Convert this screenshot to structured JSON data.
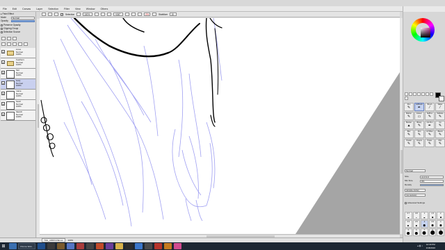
{
  "menu": {
    "items": [
      "File",
      "Edit",
      "Canvas",
      "Layer",
      "Selection",
      "Filter",
      "View",
      "Window",
      "Others"
    ]
  },
  "toolbar": {
    "selection_label": "Selection",
    "zoom": "100%",
    "angle": "+000°",
    "stabilizer_label": "Stabilizer",
    "stabilizer_value": "15",
    "red_value": "0%"
  },
  "left_panel": {
    "title": "Paint Effect",
    "mode_label": "Mode",
    "mode_value": "Normal",
    "opacity_label": "Opacity",
    "opacity_value": "100%",
    "preserve_opacity": "Preserve Opacity",
    "clipping_group": "Clipping Group",
    "selection_source": "Selection Source",
    "layers": [
      {
        "name": "Lines",
        "mode": "Normal",
        "opacity": "100%",
        "type": "folder",
        "selected": false
      },
      {
        "name": "Feathers",
        "mode": "Normal",
        "opacity": "100%",
        "type": "folder",
        "selected": false
      },
      {
        "name": "Tail",
        "mode": "Normal",
        "opacity": "100%",
        "type": "layer",
        "selected": false
      },
      {
        "name": "body",
        "mode": "Normal",
        "opacity": "100%",
        "type": "layer",
        "selected": true
      },
      {
        "name": "mane",
        "mode": "Normal",
        "opacity": "100%",
        "type": "layer",
        "selected": false
      },
      {
        "name": "head",
        "mode": "Normal",
        "opacity": "100%",
        "type": "layer",
        "selected": false
      },
      {
        "name": "Sketch",
        "mode": "Normal",
        "opacity": "100%",
        "type": "layer",
        "selected": false
      }
    ]
  },
  "status": {
    "file_tab": "TDH_ARROUNE.sai",
    "zoom": "100%"
  },
  "right_panel": {
    "tools": [
      {
        "name": "Pen",
        "glyph": "✎"
      },
      {
        "name": "AirBrush",
        "glyph": "✒"
      },
      {
        "name": "Brush",
        "glyph": "⁄"
      },
      {
        "name": "Water",
        "glyph": "⁄"
      },
      {
        "name": "Marker",
        "glyph": "✎"
      },
      {
        "name": "Eraser",
        "glyph": "▭"
      },
      {
        "name": "SelPen",
        "glyph": "✎"
      },
      {
        "name": "SelEras",
        "glyph": "✎"
      },
      {
        "name": "Bucket",
        "glyph": "▲"
      },
      {
        "name": "Binary",
        "glyph": "✎"
      },
      {
        "name": "Ink Pen",
        "glyph": "✒"
      },
      {
        "name": "Cp",
        "glyph": "✎"
      },
      {
        "name": "Blur",
        "glyph": "✎"
      },
      {
        "name": "Pen",
        "glyph": "✎"
      },
      {
        "name": "GT Blen",
        "glyph": "✎"
      },
      {
        "name": "Blend",
        "glyph": "✎"
      },
      {
        "name": "Pastel",
        "glyph": "✎"
      },
      {
        "name": "Crayon",
        "glyph": "✎"
      },
      {
        "name": "Paper",
        "glyph": "✎"
      },
      {
        "name": "Mlyr",
        "glyph": "✎"
      }
    ],
    "blend_mode": "Normal",
    "size_label": "Size",
    "size_value": "x1.0  3.0",
    "min_size_label": "Min Size",
    "min_size_value": "0%",
    "density_label": "Density",
    "density_value": "100",
    "shape1": "(simple circle)",
    "shape2": "(no texture)",
    "advanced_settings": "Advanced Settings",
    "brush_sizes": [
      "0.7",
      "0.8",
      "1",
      "1.5",
      "2",
      "2.3",
      "2.6",
      "3",
      "3.5",
      "4",
      "5",
      "6",
      "7",
      "8",
      "9"
    ],
    "selected_size": "3"
  },
  "taskbar": {
    "app_tab": "Chrome Web...",
    "time": "12:40 PM",
    "date": "1/18/2016"
  }
}
